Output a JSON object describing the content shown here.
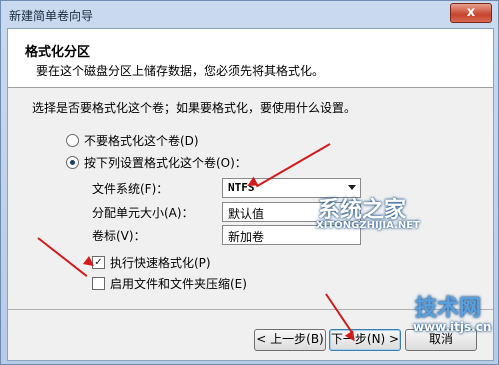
{
  "window": {
    "title": "新建简单卷向导",
    "close_label": "x"
  },
  "header": {
    "title": "格式化分区",
    "subtitle": "要在这个磁盘分区上储存数据，您必须先将其格式化。"
  },
  "question": "选择是否要格式化这个卷；如果要格式化，要使用什么设置。",
  "options": {
    "no_format": "不要格式化这个卷(D)",
    "format": "按下列设置格式化这个卷(O)："
  },
  "fields": {
    "fs_label": "文件系统(F)：",
    "fs_value": "NTFS",
    "alloc_label": "分配单元大小(A)：",
    "alloc_value": "默认值",
    "vol_label": "卷标(V)：",
    "vol_value": "新加卷"
  },
  "checks": {
    "quick_format": "执行快速格式化(P)",
    "compression": "启用文件和文件夹压缩(E)"
  },
  "buttons": {
    "back": "< 上一步(B)",
    "next": "下一步(N) >",
    "cancel": "取消"
  },
  "watermarks": {
    "site1": "系统之家",
    "site1_url": "XITONGZHIJIA.NET",
    "site2": "技术网",
    "site2_url": "www.itjs.cn"
  },
  "colors": {
    "arrow": "#d21c1c",
    "accent": "#3c7fb1"
  }
}
